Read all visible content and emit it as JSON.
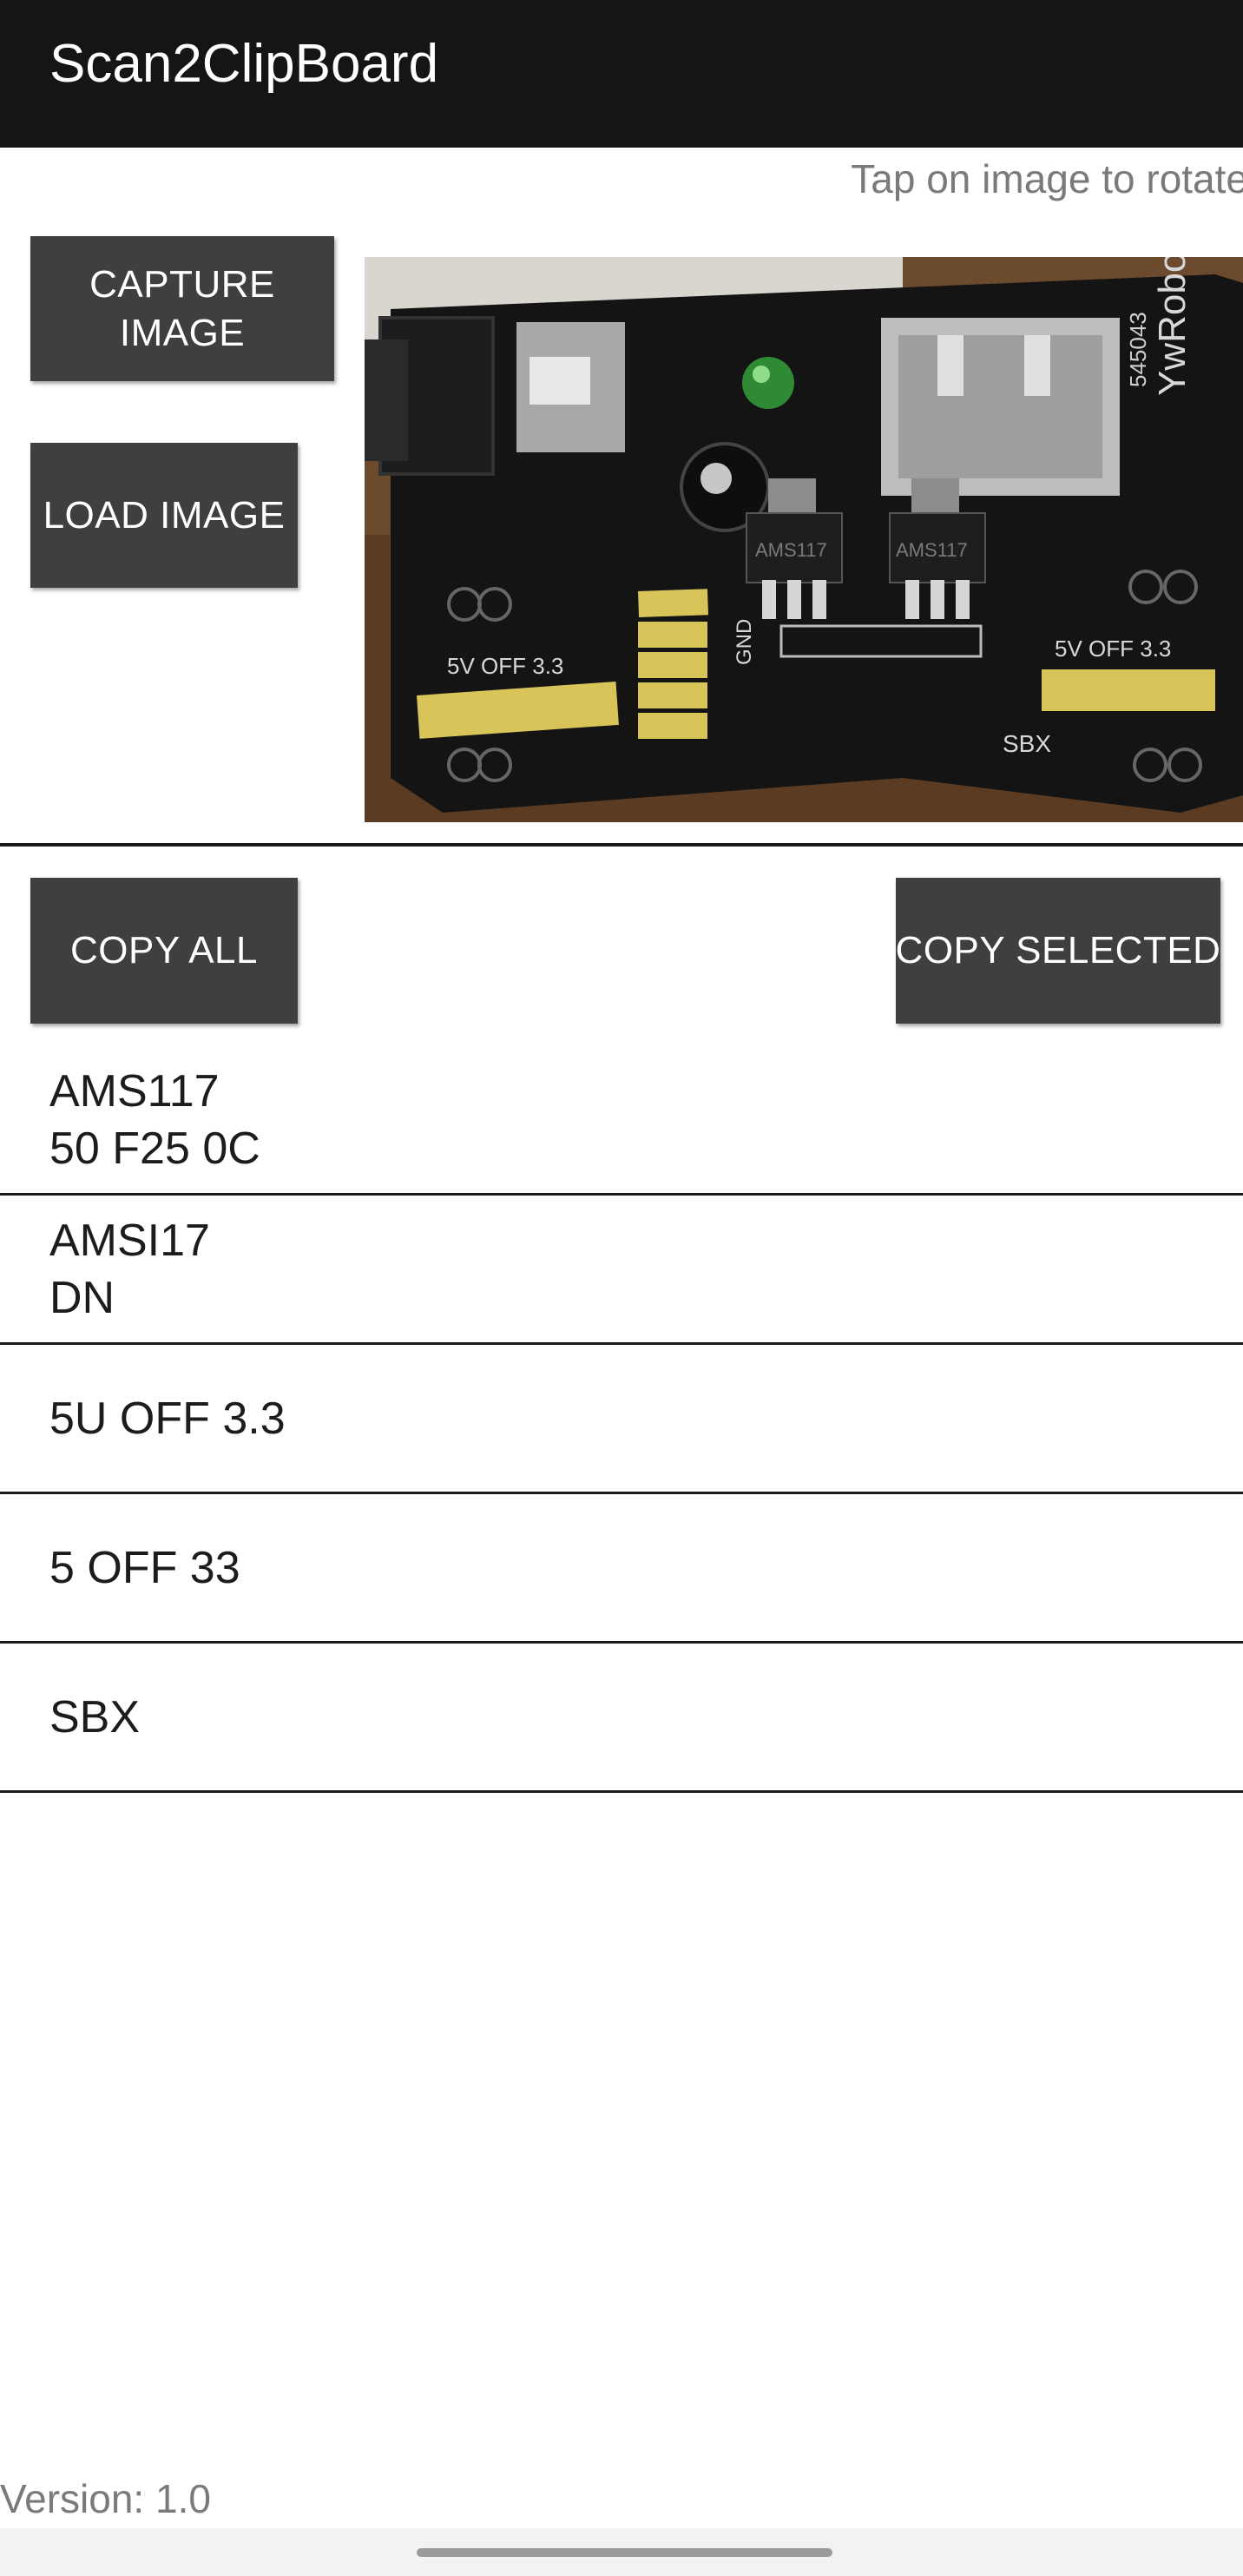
{
  "app": {
    "title": "Scan2ClipBoard"
  },
  "hint": "Tap on image to rotate",
  "buttons": {
    "capture_image": "CAPTURE IMAGE",
    "load_image": "LOAD IMAGE",
    "copy_all": "COPY ALL",
    "copy_selected": "COPY SELECTED"
  },
  "preview": {
    "board_labels": [
      "AMS117",
      "AMS117",
      "GND",
      "5V OFF 3.3",
      "5V OFF 3.3",
      "SBX",
      "YwRobot",
      "545043"
    ]
  },
  "results": [
    {
      "text": "AMS117\n50 F25 0C"
    },
    {
      "text": "AMSI17\nDN"
    },
    {
      "text": "5U OFF 3.3"
    },
    {
      "text": "5 OFF 33"
    },
    {
      "text": "SBX"
    }
  ],
  "footer": {
    "version": "Version: 1.0"
  },
  "colors": {
    "appbar": "#151515",
    "button": "#3f3f3f",
    "hint_text": "#7a7a7a"
  }
}
